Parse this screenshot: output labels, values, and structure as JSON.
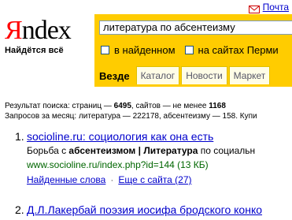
{
  "header": {
    "mail_label": "Почта"
  },
  "logo": {
    "first_letter": "Я",
    "rest": "ndex",
    "slogan": "Найдётся всё"
  },
  "search": {
    "query": "литература по абсентеизму",
    "in_found_label": "в найденном",
    "region_label": "на сайтах Перми"
  },
  "tabs": [
    {
      "label": "Везде"
    },
    {
      "label": "Каталог"
    },
    {
      "label": "Новости"
    },
    {
      "label": "Маркет"
    }
  ],
  "stats": {
    "line1_prefix": "Результат поиска: страниц — ",
    "pages": "6495",
    "line1_mid": ", сайтов — не менее ",
    "sites": "1168",
    "line2": "Запросов за месяц: литература — 222178, абсентеизму — 158. Купи"
  },
  "results": [
    {
      "num": "1.",
      "title": "socioline.ru: социология как она есть",
      "snippet_a": "Борьба с ",
      "snippet_b": "абсентеизмом",
      "snippet_c": " | ",
      "snippet_d": "Литература",
      "snippet_e": " по социальн",
      "url": "www.socioline.ru/index.php?id=144 (13 КБ)",
      "found_words": "Найденные слова",
      "more_from_site": "Еще с сайта (27)"
    },
    {
      "num": "2.",
      "title": "Д.Л.Лакербай поэзия иосифа бродского конко"
    }
  ]
}
